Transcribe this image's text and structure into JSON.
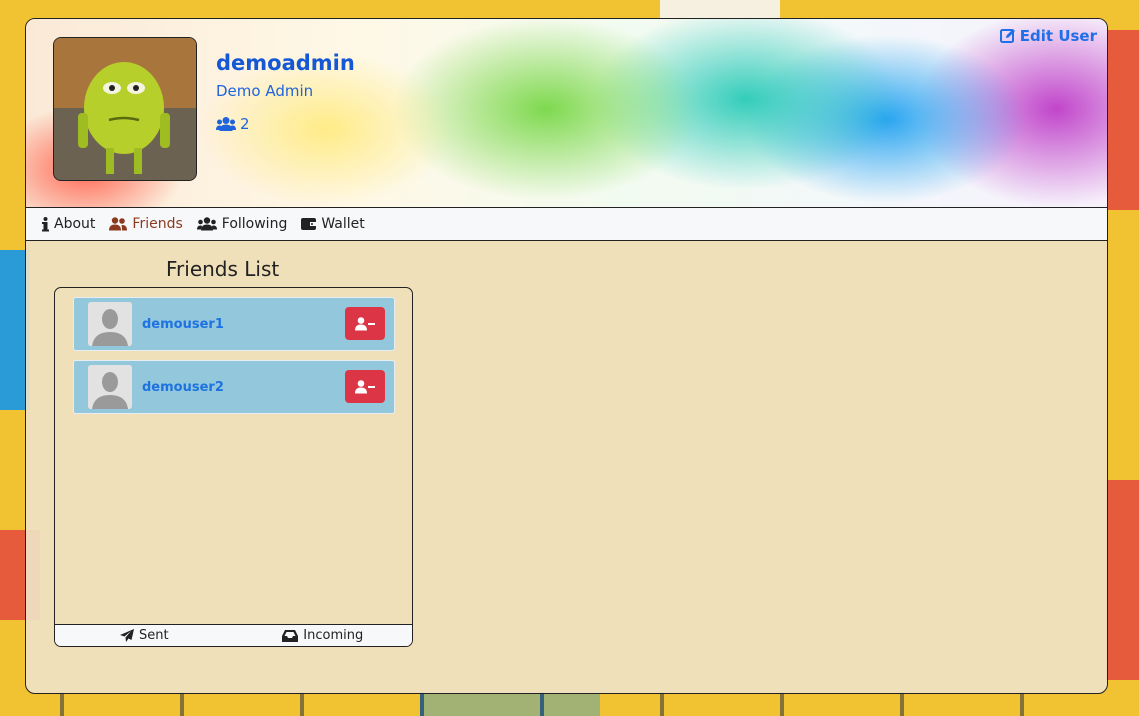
{
  "profile": {
    "username": "demoadmin",
    "full_name": "Demo Admin",
    "friend_count": "2",
    "edit_label": "Edit User"
  },
  "nav": {
    "items": [
      {
        "label": "About",
        "icon": "info-icon"
      },
      {
        "label": "Friends",
        "icon": "user-friends-icon",
        "active": true
      },
      {
        "label": "Following",
        "icon": "users-icon"
      },
      {
        "label": "Wallet",
        "icon": "wallet-icon"
      }
    ]
  },
  "friends": {
    "title": "Friends List",
    "list": [
      {
        "name": "demouser1"
      },
      {
        "name": "demouser2"
      }
    ],
    "footer": {
      "sent_label": "Sent",
      "incoming_label": "Incoming"
    }
  },
  "colors": {
    "link_blue": "#1558d6",
    "active_nav": "#8b3a20",
    "remove_red": "#dc3545",
    "friend_row_bg": "#92c7dc"
  }
}
